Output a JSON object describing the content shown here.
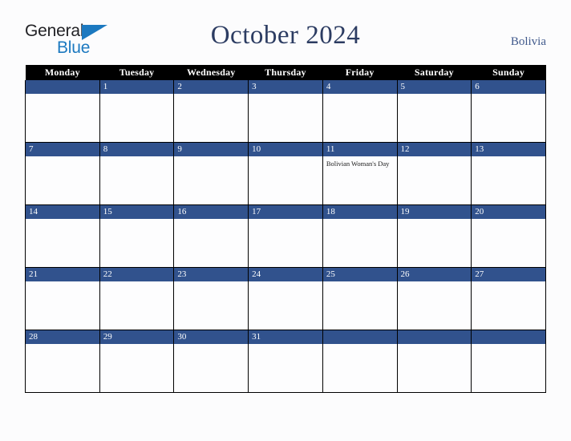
{
  "brand": {
    "line1": "General",
    "line2": "Blue",
    "triangle_icon": "triangle-icon",
    "accent_blue": "#1c79c0",
    "dark_text": "#222226"
  },
  "header": {
    "title": "October 2024",
    "country": "Bolivia",
    "title_color": "#2c3c62"
  },
  "calendar": {
    "weekday_headers": [
      "Monday",
      "Tuesday",
      "Wednesday",
      "Thursday",
      "Friday",
      "Saturday",
      "Sunday"
    ],
    "header_bg": "#000000",
    "header_text": "#ffffff",
    "daynum_band_bg": "#31528d",
    "daynum_text": "#ffffff",
    "cell_bg": "#fdfdfe",
    "grid_line": "#000000",
    "weeks": [
      [
        {
          "day": "",
          "event": ""
        },
        {
          "day": "1",
          "event": ""
        },
        {
          "day": "2",
          "event": ""
        },
        {
          "day": "3",
          "event": ""
        },
        {
          "day": "4",
          "event": ""
        },
        {
          "day": "5",
          "event": ""
        },
        {
          "day": "6",
          "event": ""
        }
      ],
      [
        {
          "day": "7",
          "event": ""
        },
        {
          "day": "8",
          "event": ""
        },
        {
          "day": "9",
          "event": ""
        },
        {
          "day": "10",
          "event": ""
        },
        {
          "day": "11",
          "event": "Bolivian Woman's Day"
        },
        {
          "day": "12",
          "event": ""
        },
        {
          "day": "13",
          "event": ""
        }
      ],
      [
        {
          "day": "14",
          "event": ""
        },
        {
          "day": "15",
          "event": ""
        },
        {
          "day": "16",
          "event": ""
        },
        {
          "day": "17",
          "event": ""
        },
        {
          "day": "18",
          "event": ""
        },
        {
          "day": "19",
          "event": ""
        },
        {
          "day": "20",
          "event": ""
        }
      ],
      [
        {
          "day": "21",
          "event": ""
        },
        {
          "day": "22",
          "event": ""
        },
        {
          "day": "23",
          "event": ""
        },
        {
          "day": "24",
          "event": ""
        },
        {
          "day": "25",
          "event": ""
        },
        {
          "day": "26",
          "event": ""
        },
        {
          "day": "27",
          "event": ""
        }
      ],
      [
        {
          "day": "28",
          "event": ""
        },
        {
          "day": "29",
          "event": ""
        },
        {
          "day": "30",
          "event": ""
        },
        {
          "day": "31",
          "event": ""
        },
        {
          "day": "",
          "event": ""
        },
        {
          "day": "",
          "event": ""
        },
        {
          "day": "",
          "event": ""
        }
      ]
    ]
  }
}
